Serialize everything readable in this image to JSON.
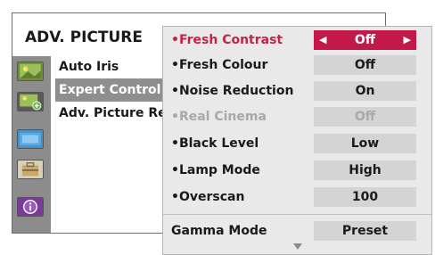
{
  "back_panel": {
    "title": "ADV. PICTURE",
    "items": [
      {
        "label": "Auto Iris"
      },
      {
        "label": "Expert Control"
      },
      {
        "label": "Adv. Picture Res"
      }
    ],
    "icons": [
      "picture-icon",
      "picture-settings-icon",
      "screen-icon",
      "toolbox-icon",
      "info-icon"
    ]
  },
  "front_panel": {
    "rows": [
      {
        "label": "•Fresh Contrast",
        "value": "Off"
      },
      {
        "label": "•Fresh Colour",
        "value": "Off"
      },
      {
        "label": "•Noise Reduction",
        "value": "On"
      },
      {
        "label": "•Real Cinema",
        "value": "Off"
      },
      {
        "label": "•Black Level",
        "value": "Low"
      },
      {
        "label": "•Lamp Mode",
        "value": "High"
      },
      {
        "label": "•Overscan",
        "value": "100"
      },
      {
        "label": "Gamma Mode",
        "value": "Preset"
      }
    ],
    "arrow_left": "◀",
    "arrow_right": "▶"
  },
  "colors": {
    "accent": "#c2184a",
    "selected_label": "#c0244d",
    "disabled": "#a8a8a8"
  }
}
